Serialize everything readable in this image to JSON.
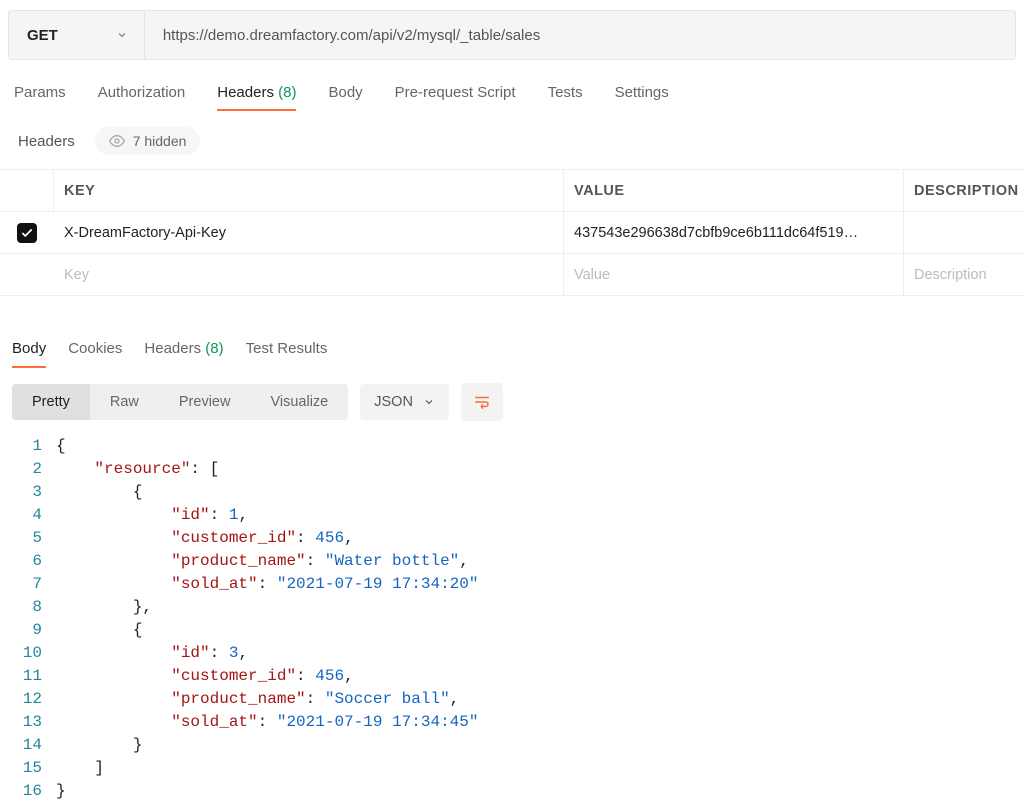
{
  "request": {
    "method": "GET",
    "url": "https://demo.dreamfactory.com/api/v2/mysql/_table/sales"
  },
  "request_tabs": {
    "items": [
      "Params",
      "Authorization",
      "Headers",
      "Body",
      "Pre-request Script",
      "Tests",
      "Settings"
    ],
    "active_index": 2,
    "headers_count": "(8)"
  },
  "headers_subbar": {
    "label": "Headers",
    "hidden_label": "7 hidden"
  },
  "headers_table": {
    "columns": {
      "key": "KEY",
      "value": "VALUE",
      "description": "DESCRIPTION"
    },
    "rows": [
      {
        "checked": true,
        "key": "X-DreamFactory-Api-Key",
        "value": "437543e296638d7cbfb9ce6b111dc64f519…",
        "description": ""
      }
    ],
    "placeholder": {
      "key": "Key",
      "value": "Value",
      "description": "Description"
    }
  },
  "response_tabs": {
    "items": [
      "Body",
      "Cookies",
      "Headers",
      "Test Results"
    ],
    "active_index": 0,
    "headers_count": "(8)"
  },
  "view_modes": {
    "items": [
      "Pretty",
      "Raw",
      "Preview",
      "Visualize"
    ],
    "active_index": 0
  },
  "format_dropdown": {
    "label": "JSON"
  },
  "response_body": {
    "resource": [
      {
        "id": 1,
        "customer_id": 456,
        "product_name": "Water bottle",
        "sold_at": "2021-07-19 17:34:20"
      },
      {
        "id": 3,
        "customer_id": 456,
        "product_name": "Soccer ball",
        "sold_at": "2021-07-19 17:34:45"
      }
    ]
  },
  "code_lines": {
    "count": 16,
    "tokens": [
      [
        {
          "t": "punc",
          "v": "{"
        }
      ],
      [
        {
          "t": "indent",
          "n": 1
        },
        {
          "t": "key",
          "v": "\"resource\""
        },
        {
          "t": "punc",
          "v": ": ["
        }
      ],
      [
        {
          "t": "indent",
          "n": 2
        },
        {
          "t": "punc",
          "v": "{"
        }
      ],
      [
        {
          "t": "indent",
          "n": 3
        },
        {
          "t": "key",
          "v": "\"id\""
        },
        {
          "t": "punc",
          "v": ": "
        },
        {
          "t": "num",
          "v": "1"
        },
        {
          "t": "punc",
          "v": ","
        }
      ],
      [
        {
          "t": "indent",
          "n": 3
        },
        {
          "t": "key",
          "v": "\"customer_id\""
        },
        {
          "t": "punc",
          "v": ": "
        },
        {
          "t": "num",
          "v": "456"
        },
        {
          "t": "punc",
          "v": ","
        }
      ],
      [
        {
          "t": "indent",
          "n": 3
        },
        {
          "t": "key",
          "v": "\"product_name\""
        },
        {
          "t": "punc",
          "v": ": "
        },
        {
          "t": "str",
          "v": "\"Water bottle\""
        },
        {
          "t": "punc",
          "v": ","
        }
      ],
      [
        {
          "t": "indent",
          "n": 3
        },
        {
          "t": "key",
          "v": "\"sold_at\""
        },
        {
          "t": "punc",
          "v": ": "
        },
        {
          "t": "str",
          "v": "\"2021-07-19 17:34:20\""
        }
      ],
      [
        {
          "t": "indent",
          "n": 2
        },
        {
          "t": "punc",
          "v": "},"
        }
      ],
      [
        {
          "t": "indent",
          "n": 2
        },
        {
          "t": "punc",
          "v": "{"
        }
      ],
      [
        {
          "t": "indent",
          "n": 3
        },
        {
          "t": "key",
          "v": "\"id\""
        },
        {
          "t": "punc",
          "v": ": "
        },
        {
          "t": "num",
          "v": "3"
        },
        {
          "t": "punc",
          "v": ","
        }
      ],
      [
        {
          "t": "indent",
          "n": 3
        },
        {
          "t": "key",
          "v": "\"customer_id\""
        },
        {
          "t": "punc",
          "v": ": "
        },
        {
          "t": "num",
          "v": "456"
        },
        {
          "t": "punc",
          "v": ","
        }
      ],
      [
        {
          "t": "indent",
          "n": 3
        },
        {
          "t": "key",
          "v": "\"product_name\""
        },
        {
          "t": "punc",
          "v": ": "
        },
        {
          "t": "str",
          "v": "\"Soccer ball\""
        },
        {
          "t": "punc",
          "v": ","
        }
      ],
      [
        {
          "t": "indent",
          "n": 3
        },
        {
          "t": "key",
          "v": "\"sold_at\""
        },
        {
          "t": "punc",
          "v": ": "
        },
        {
          "t": "str",
          "v": "\"2021-07-19 17:34:45\""
        }
      ],
      [
        {
          "t": "indent",
          "n": 2
        },
        {
          "t": "punc",
          "v": "}"
        }
      ],
      [
        {
          "t": "indent",
          "n": 1
        },
        {
          "t": "punc",
          "v": "]"
        }
      ],
      [
        {
          "t": "punc",
          "v": "}"
        }
      ]
    ]
  }
}
